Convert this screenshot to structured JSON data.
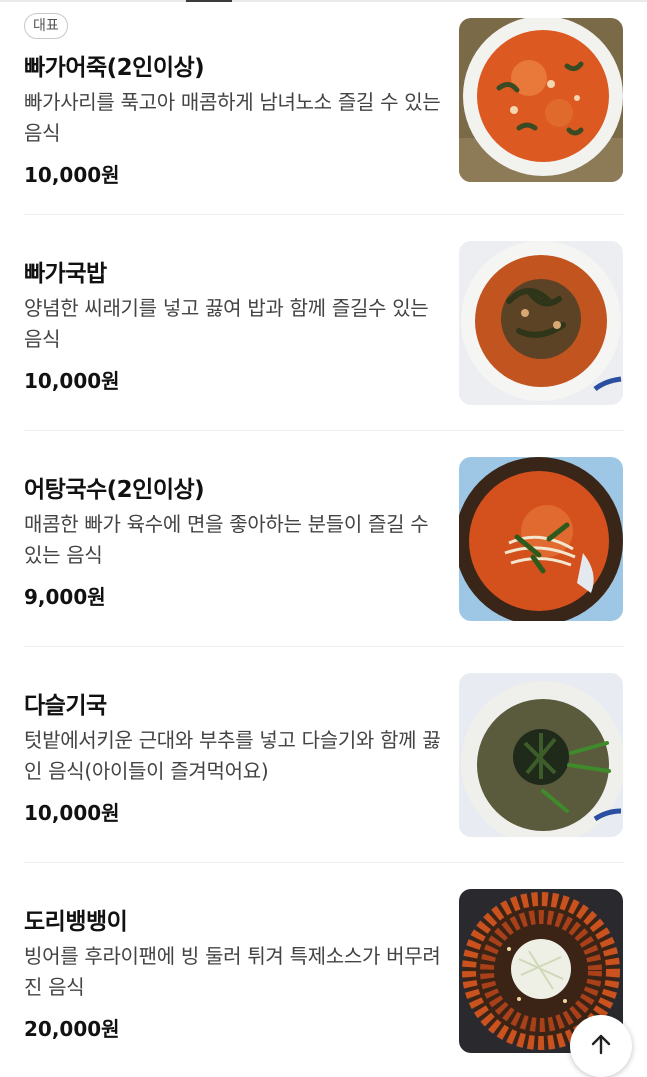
{
  "menu": {
    "badge": "대표",
    "items": [
      {
        "name": "빠가어죽(2인이상)",
        "desc": "빠가사리를 푹고아 매콤하게 남녀노소 즐길 수 있는 음식",
        "price": "10,000원",
        "image": "spicy-fish-porridge-photo"
      },
      {
        "name": "빠가국밥",
        "desc": "양념한 씨래기를 넣고 끓여 밥과 함께 즐길수 있는 음식",
        "price": "10,000원",
        "image": "fish-soup-rice-photo"
      },
      {
        "name": "어탕국수(2인이상)",
        "desc": "매콤한 빠가 육수에 면을 좋아하는 분들이 즐길 수 있는 음식",
        "price": "9,000원",
        "image": "fish-noodle-soup-photo"
      },
      {
        "name": "다슬기국",
        "desc": "텃밭에서키운 근대와 부추를 넣고 다슬기와 함께 끓인 음식(아이들이 즐겨먹어요)",
        "price": "10,000원",
        "image": "marsh-snail-soup-photo"
      },
      {
        "name": "도리뱅뱅이",
        "desc": "빙어를 후라이팬에 빙 둘러 튀겨 특제소스가 버무려진 음식",
        "price": "20,000원",
        "image": "fried-smelt-platter-photo"
      }
    ]
  },
  "scroll_top": {
    "icon": "arrow-up-icon"
  },
  "colors": {
    "text_primary": "#111111",
    "text_secondary": "#444444",
    "divider": "#eeeeee",
    "badge_border": "#c9c9c9"
  }
}
